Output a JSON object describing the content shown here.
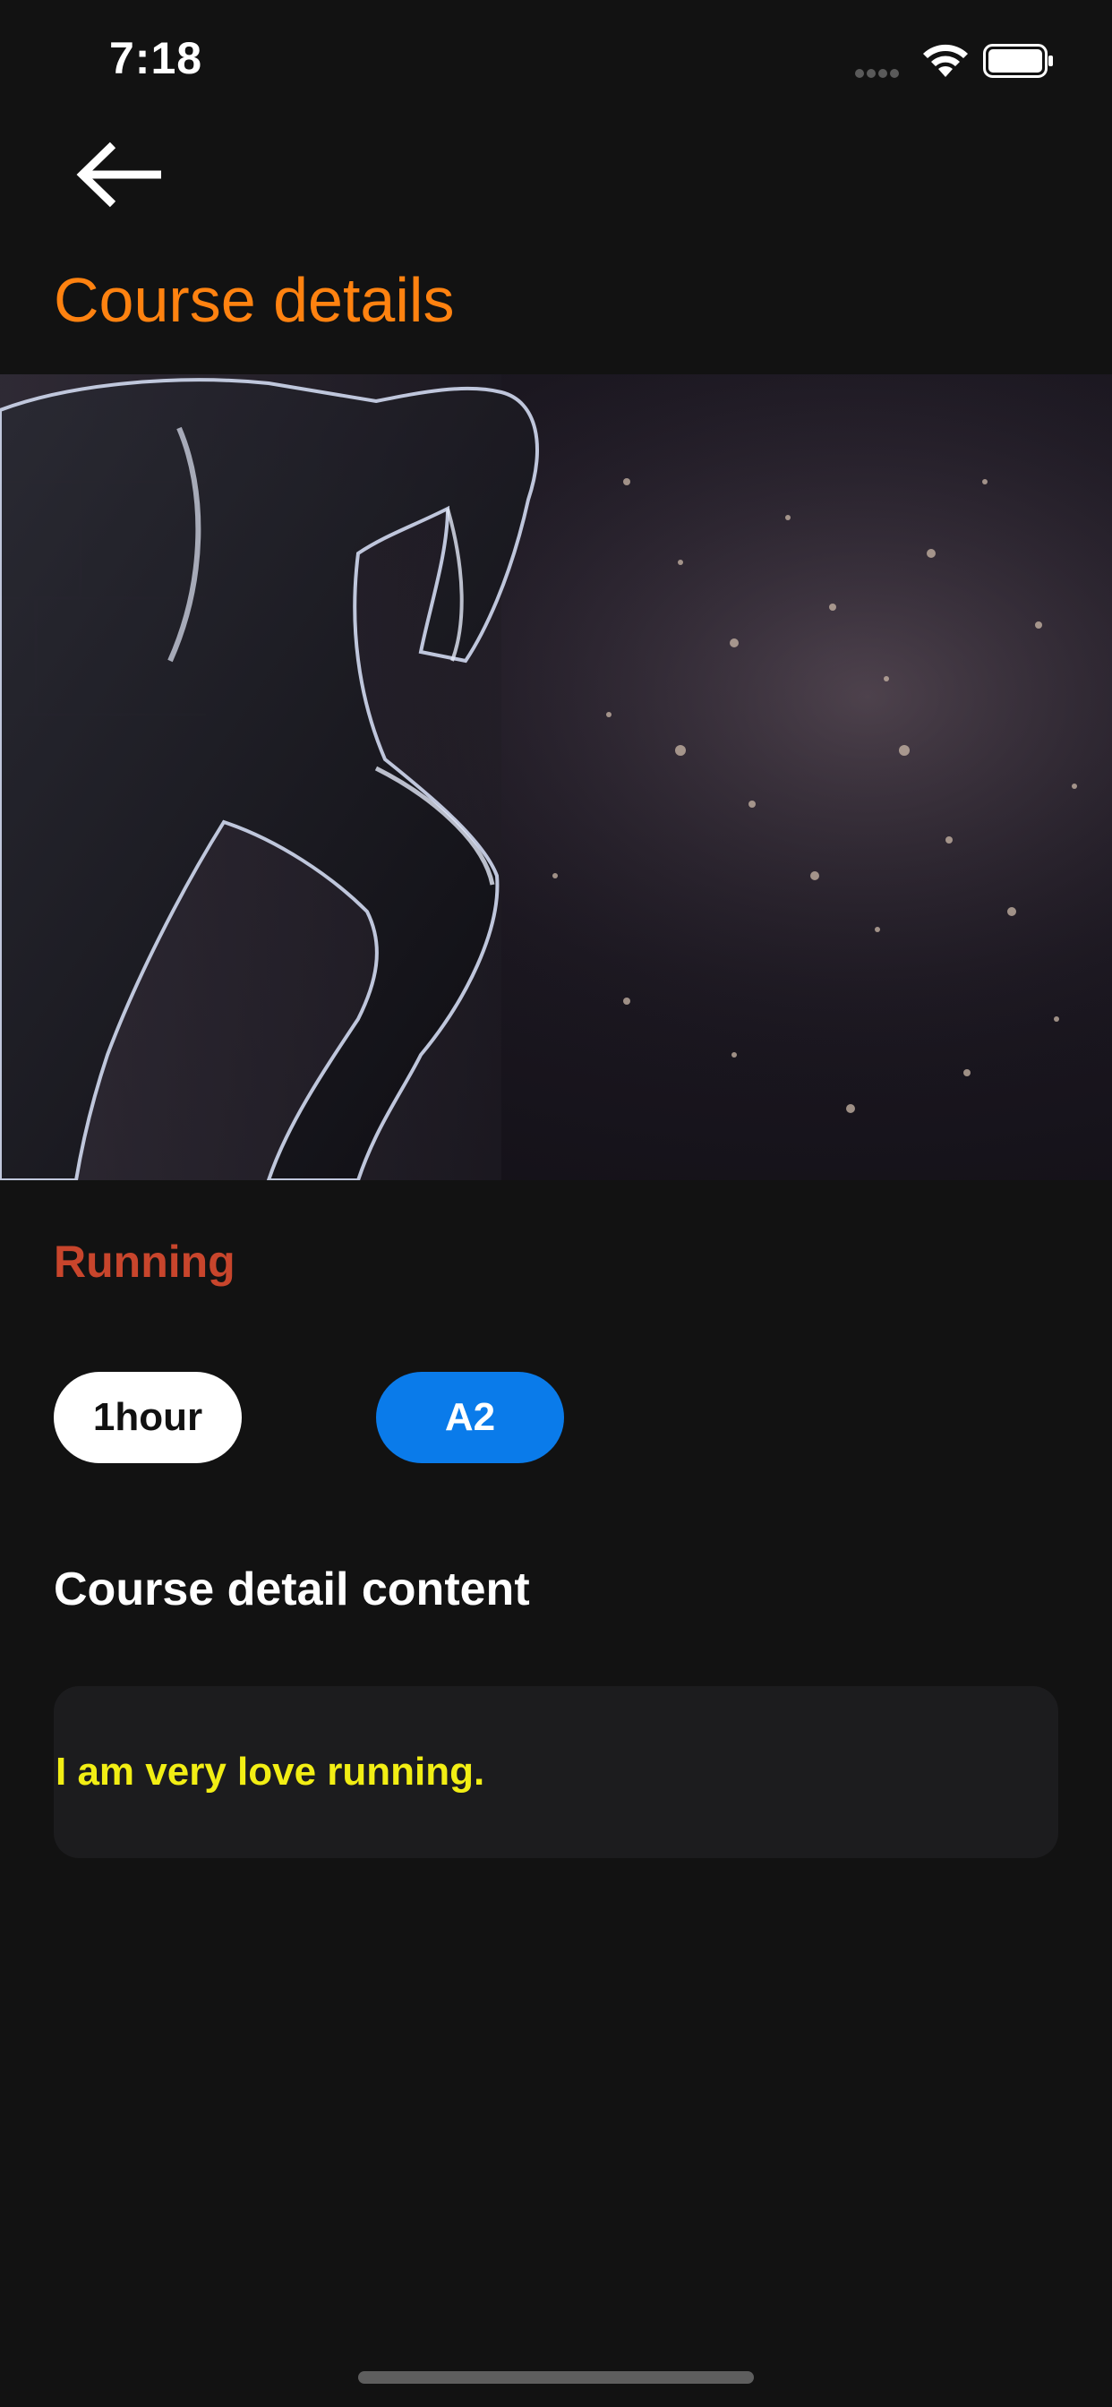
{
  "status_bar": {
    "time": "7:18"
  },
  "header": {
    "title": "Course details",
    "back_icon": "arrow-left-icon"
  },
  "course": {
    "name": "Running",
    "duration": "1hour",
    "level": "A2",
    "content_heading": "Course detail content",
    "content_text": "I am very love running."
  },
  "colors": {
    "background": "#121212",
    "title_accent": "#ff8210",
    "course_name": "#c8452c",
    "level_chip": "#0a7bea",
    "content_text": "#f2ee14",
    "card_background": "#1c1c1e"
  }
}
